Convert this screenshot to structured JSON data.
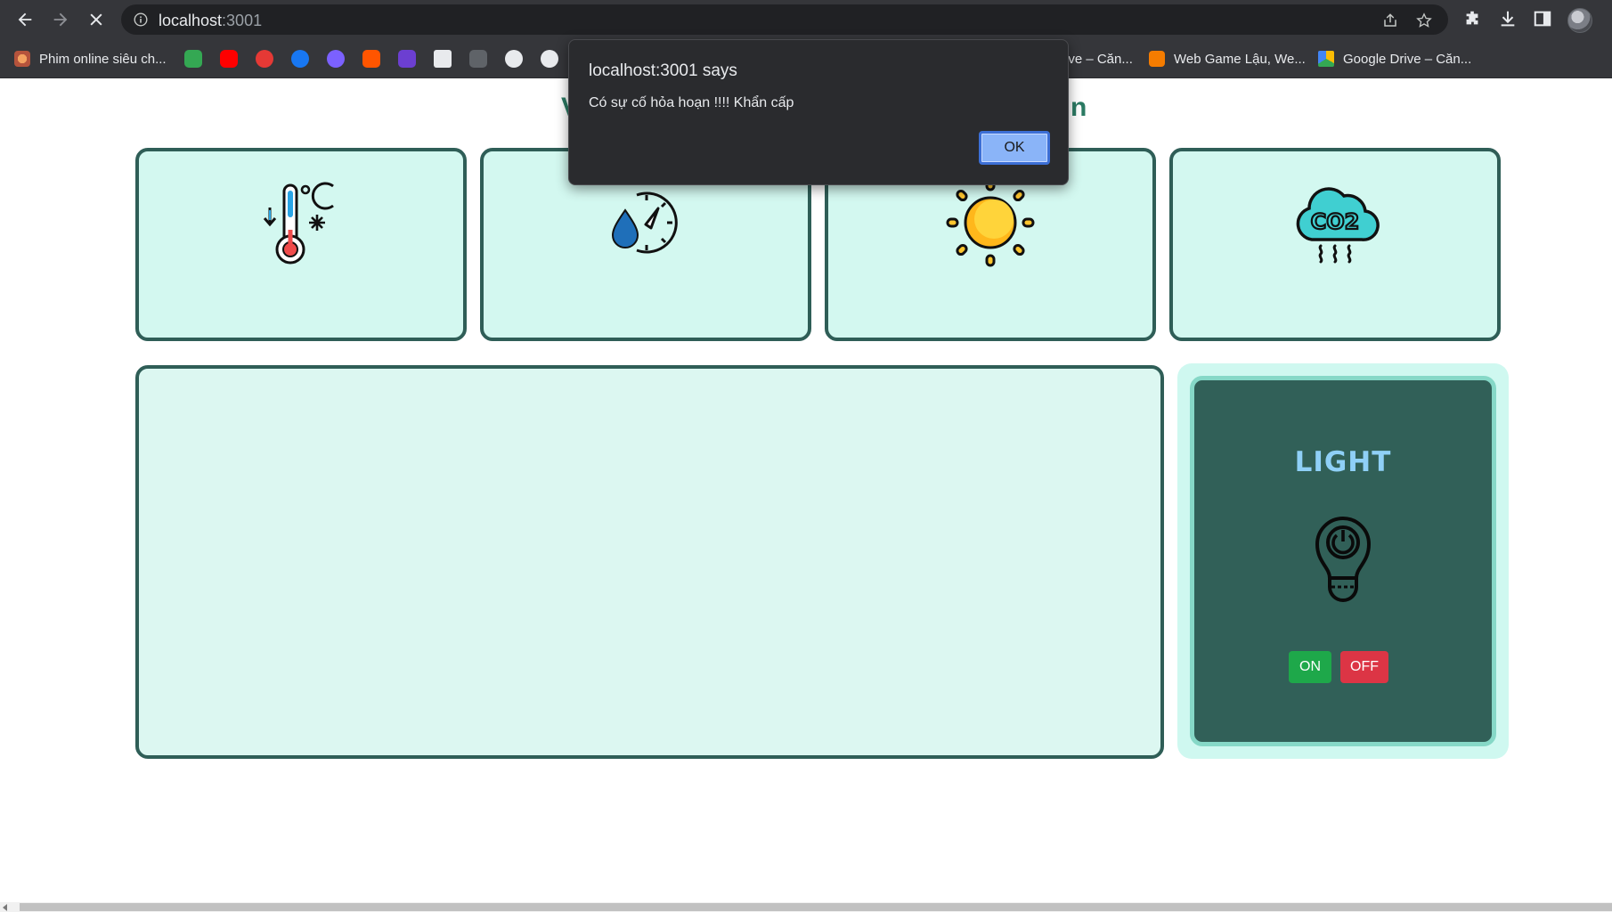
{
  "browser": {
    "url_host": "localhost",
    "url_port": ":3001",
    "bookmarks": [
      {
        "label": "Phim online siêu ch...",
        "color": "#e07a5f"
      },
      {
        "label": "ive – Căn...",
        "color": "#34a853"
      },
      {
        "label": "Web Game Lậu, We...",
        "color": "#f57c00"
      },
      {
        "label": "Google Drive – Căn...",
        "color": "#fbbc04"
      }
    ]
  },
  "page": {
    "title_left": "V",
    "title_right": "n"
  },
  "cards": [
    {
      "icon": "thermometer-icon"
    },
    {
      "icon": "humidity-gauge-icon"
    },
    {
      "icon": "sun-icon"
    },
    {
      "icon": "co2-cloud-icon"
    }
  ],
  "light_panel": {
    "title": "LIGHT",
    "on_label": "ON",
    "off_label": "OFF",
    "on_color": "#1ea84a",
    "off_color": "#dc3545"
  },
  "alert": {
    "title": "localhost:3001 says",
    "message": "Có sự cố hỏa hoạn !!!! Khẩn cấp",
    "ok_label": "OK"
  }
}
